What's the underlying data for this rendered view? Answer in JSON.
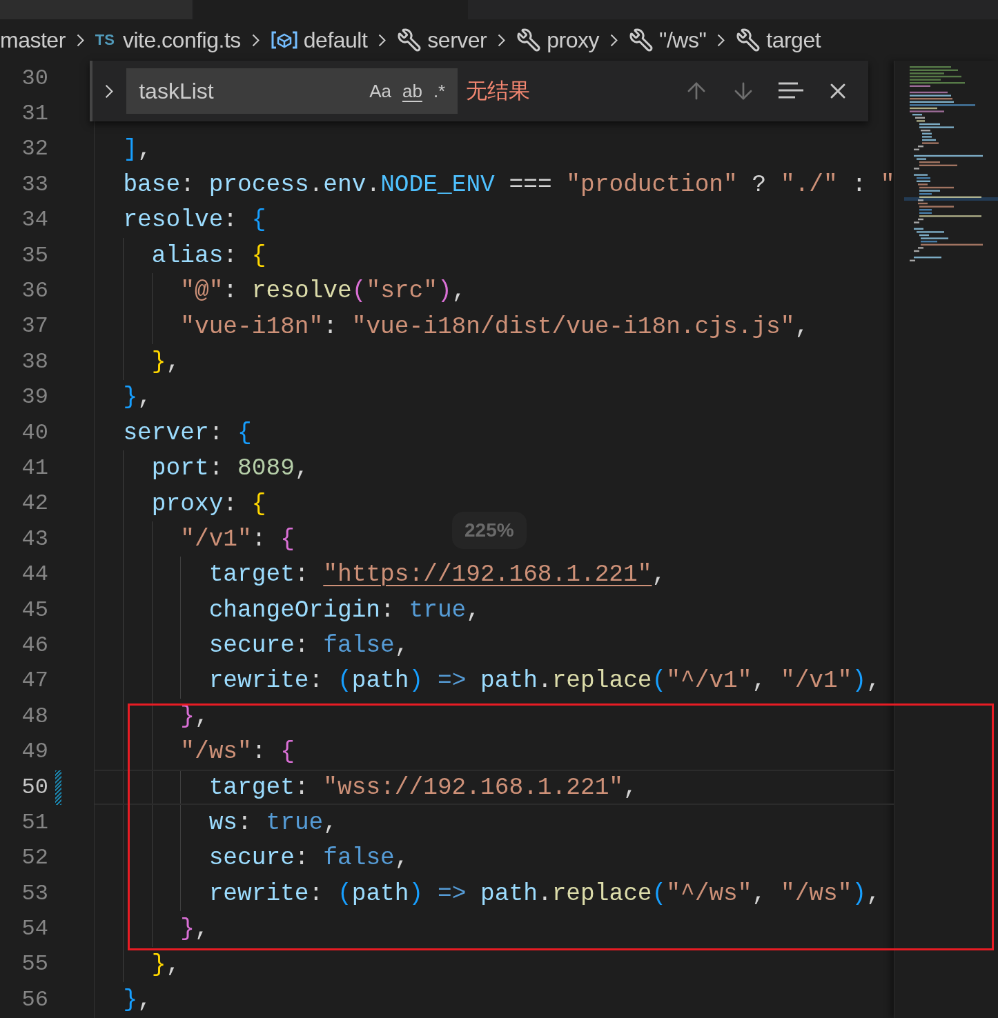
{
  "breadcrumb": [
    {
      "label": "master",
      "kind": "branch"
    },
    {
      "label": "vite.config.ts",
      "kind": "file",
      "badge": "TS"
    },
    {
      "label": "default",
      "kind": "variable"
    },
    {
      "label": "server",
      "kind": "property"
    },
    {
      "label": "proxy",
      "kind": "property"
    },
    {
      "label": "\"/ws\"",
      "kind": "property"
    },
    {
      "label": "target",
      "kind": "property"
    }
  ],
  "find_widget": {
    "expanded": false,
    "value": "taskList",
    "options": [
      {
        "label": "Aa",
        "selected": false
      },
      {
        "label": "ab",
        "selected": false
      },
      {
        "label": ".*",
        "selected": false
      }
    ],
    "result": "无结果"
  },
  "lines": [
    {
      "number": "30",
      "current": false,
      "modified": false
    },
    {
      "number": "31",
      "current": false,
      "modified": false
    },
    {
      "number": "32",
      "current": false,
      "modified": false,
      "tokens": [
        {
          "text": "  ]",
          "kind": "bracket1"
        },
        {
          "text": ",",
          "kind": "punct"
        }
      ]
    },
    {
      "number": "33",
      "current": false,
      "modified": false,
      "tokens": [
        {
          "text": "  base",
          "kind": "prop"
        },
        {
          "text": ": ",
          "kind": "punct"
        },
        {
          "text": "process",
          "kind": "prop"
        },
        {
          "text": ".",
          "kind": "punct"
        },
        {
          "text": "env",
          "kind": "prop"
        },
        {
          "text": ".",
          "kind": "punct"
        },
        {
          "text": "NODE_ENV",
          "kind": "const"
        },
        {
          "text": " === ",
          "kind": "punct"
        },
        {
          "text": "\"production\"",
          "kind": "string"
        },
        {
          "text": " ? ",
          "kind": "punct"
        },
        {
          "text": "\"./\"",
          "kind": "string"
        },
        {
          "text": " : ",
          "kind": "punct"
        },
        {
          "text": "\"",
          "kind": "string"
        }
      ]
    },
    {
      "number": "34",
      "current": false,
      "modified": false,
      "tokens": [
        {
          "text": "  resolve",
          "kind": "prop"
        },
        {
          "text": ": ",
          "kind": "punct"
        },
        {
          "text": "{",
          "kind": "bracket1"
        }
      ]
    },
    {
      "number": "35",
      "current": false,
      "modified": false,
      "tokens": [
        {
          "text": "    alias",
          "kind": "prop"
        },
        {
          "text": ": ",
          "kind": "punct"
        },
        {
          "text": "{",
          "kind": "bracket2"
        }
      ]
    },
    {
      "number": "36",
      "current": false,
      "modified": false,
      "tokens": [
        {
          "text": "      \"@\"",
          "kind": "string"
        },
        {
          "text": ": ",
          "kind": "punct"
        },
        {
          "text": "resolve",
          "kind": "func"
        },
        {
          "text": "(",
          "kind": "bracket3"
        },
        {
          "text": "\"src\"",
          "kind": "string"
        },
        {
          "text": ")",
          "kind": "bracket3"
        },
        {
          "text": ",",
          "kind": "punct"
        }
      ]
    },
    {
      "number": "37",
      "current": false,
      "modified": false,
      "tokens": [
        {
          "text": "      \"vue-i18n\"",
          "kind": "string"
        },
        {
          "text": ": ",
          "kind": "punct"
        },
        {
          "text": "\"vue-i18n/dist/vue-i18n.cjs.js\"",
          "kind": "string"
        },
        {
          "text": ",",
          "kind": "punct"
        }
      ]
    },
    {
      "number": "38",
      "current": false,
      "modified": false,
      "tokens": [
        {
          "text": "    }",
          "kind": "bracket2"
        },
        {
          "text": ",",
          "kind": "punct"
        }
      ]
    },
    {
      "number": "39",
      "current": false,
      "modified": false,
      "tokens": [
        {
          "text": "  }",
          "kind": "bracket1"
        },
        {
          "text": ",",
          "kind": "punct"
        }
      ]
    },
    {
      "number": "40",
      "current": false,
      "modified": false,
      "tokens": [
        {
          "text": "  server",
          "kind": "prop"
        },
        {
          "text": ": ",
          "kind": "punct"
        },
        {
          "text": "{",
          "kind": "bracket1"
        }
      ]
    },
    {
      "number": "41",
      "current": false,
      "modified": false,
      "tokens": [
        {
          "text": "    port",
          "kind": "prop"
        },
        {
          "text": ": ",
          "kind": "punct"
        },
        {
          "text": "8089",
          "kind": "number"
        },
        {
          "text": ",",
          "kind": "punct"
        }
      ]
    },
    {
      "number": "42",
      "current": false,
      "modified": false,
      "tokens": [
        {
          "text": "    proxy",
          "kind": "prop"
        },
        {
          "text": ": ",
          "kind": "punct"
        },
        {
          "text": "{",
          "kind": "bracket2"
        }
      ]
    },
    {
      "number": "43",
      "current": false,
      "modified": false,
      "tokens": [
        {
          "text": "      \"/v1\"",
          "kind": "string"
        },
        {
          "text": ": ",
          "kind": "punct"
        },
        {
          "text": "{",
          "kind": "bracket3"
        }
      ]
    },
    {
      "number": "44",
      "current": false,
      "modified": false,
      "tokens": [
        {
          "text": "        target",
          "kind": "prop"
        },
        {
          "text": ": ",
          "kind": "punct"
        },
        {
          "text": "\"https://192.168.1.221\"",
          "kind": "link"
        },
        {
          "text": ",",
          "kind": "punct"
        }
      ]
    },
    {
      "number": "45",
      "current": false,
      "modified": false,
      "tokens": [
        {
          "text": "        changeOrigin",
          "kind": "prop"
        },
        {
          "text": ": ",
          "kind": "punct"
        },
        {
          "text": "true",
          "kind": "keyword"
        },
        {
          "text": ",",
          "kind": "punct"
        }
      ]
    },
    {
      "number": "46",
      "current": false,
      "modified": false,
      "tokens": [
        {
          "text": "        secure",
          "kind": "prop"
        },
        {
          "text": ": ",
          "kind": "punct"
        },
        {
          "text": "false",
          "kind": "keyword"
        },
        {
          "text": ",",
          "kind": "punct"
        }
      ]
    },
    {
      "number": "47",
      "current": false,
      "modified": false,
      "tokens": [
        {
          "text": "        rewrite",
          "kind": "prop"
        },
        {
          "text": ": ",
          "kind": "punct"
        },
        {
          "text": "(",
          "kind": "bracket1"
        },
        {
          "text": "path",
          "kind": "prop"
        },
        {
          "text": ")",
          "kind": "bracket1"
        },
        {
          "text": " => ",
          "kind": "keyword"
        },
        {
          "text": "path",
          "kind": "prop"
        },
        {
          "text": ".",
          "kind": "punct"
        },
        {
          "text": "replace",
          "kind": "func"
        },
        {
          "text": "(",
          "kind": "bracket1"
        },
        {
          "text": "\"^/v1\"",
          "kind": "string"
        },
        {
          "text": ", ",
          "kind": "punct"
        },
        {
          "text": "\"/v1\"",
          "kind": "string"
        },
        {
          "text": ")",
          "kind": "bracket1"
        },
        {
          "text": ",",
          "kind": "punct"
        }
      ]
    },
    {
      "number": "48",
      "current": false,
      "modified": false,
      "tokens": [
        {
          "text": "      }",
          "kind": "bracket3"
        },
        {
          "text": ",",
          "kind": "punct"
        }
      ]
    },
    {
      "number": "49",
      "current": false,
      "modified": false,
      "tokens": [
        {
          "text": "      \"/ws\"",
          "kind": "string"
        },
        {
          "text": ": ",
          "kind": "punct"
        },
        {
          "text": "{",
          "kind": "bracket3"
        }
      ]
    },
    {
      "number": "50",
      "current": true,
      "modified": true,
      "tokens": [
        {
          "text": "        target",
          "kind": "prop"
        },
        {
          "text": ": ",
          "kind": "punct"
        },
        {
          "text": "\"wss://192.168.1.221\"",
          "kind": "string"
        },
        {
          "text": ",",
          "kind": "punct"
        }
      ]
    },
    {
      "number": "51",
      "current": false,
      "modified": false,
      "tokens": [
        {
          "text": "        ws",
          "kind": "prop"
        },
        {
          "text": ": ",
          "kind": "punct"
        },
        {
          "text": "true",
          "kind": "keyword"
        },
        {
          "text": ",",
          "kind": "punct"
        }
      ]
    },
    {
      "number": "52",
      "current": false,
      "modified": false,
      "tokens": [
        {
          "text": "        secure",
          "kind": "prop"
        },
        {
          "text": ": ",
          "kind": "punct"
        },
        {
          "text": "false",
          "kind": "keyword"
        },
        {
          "text": ",",
          "kind": "punct"
        }
      ]
    },
    {
      "number": "53",
      "current": false,
      "modified": false,
      "tokens": [
        {
          "text": "        rewrite",
          "kind": "prop"
        },
        {
          "text": ": ",
          "kind": "punct"
        },
        {
          "text": "(",
          "kind": "bracket1"
        },
        {
          "text": "path",
          "kind": "prop"
        },
        {
          "text": ")",
          "kind": "bracket1"
        },
        {
          "text": " => ",
          "kind": "keyword"
        },
        {
          "text": "path",
          "kind": "prop"
        },
        {
          "text": ".",
          "kind": "punct"
        },
        {
          "text": "replace",
          "kind": "func"
        },
        {
          "text": "(",
          "kind": "bracket1"
        },
        {
          "text": "\"^/ws\"",
          "kind": "string"
        },
        {
          "text": ", ",
          "kind": "punct"
        },
        {
          "text": "\"/ws\"",
          "kind": "string"
        },
        {
          "text": ")",
          "kind": "bracket1"
        },
        {
          "text": ",",
          "kind": "punct"
        }
      ]
    },
    {
      "number": "54",
      "current": false,
      "modified": false,
      "tokens": [
        {
          "text": "      }",
          "kind": "bracket3"
        },
        {
          "text": ",",
          "kind": "punct"
        }
      ]
    },
    {
      "number": "55",
      "current": false,
      "modified": false,
      "tokens": [
        {
          "text": "    }",
          "kind": "bracket2"
        },
        {
          "text": ",",
          "kind": "punct"
        }
      ]
    },
    {
      "number": "56",
      "current": false,
      "modified": false,
      "tokens": [
        {
          "text": "  }",
          "kind": "bracket1"
        },
        {
          "text": ",",
          "kind": "punct"
        }
      ]
    }
  ],
  "zoom_indicator": "225%",
  "highlight_frame": true
}
